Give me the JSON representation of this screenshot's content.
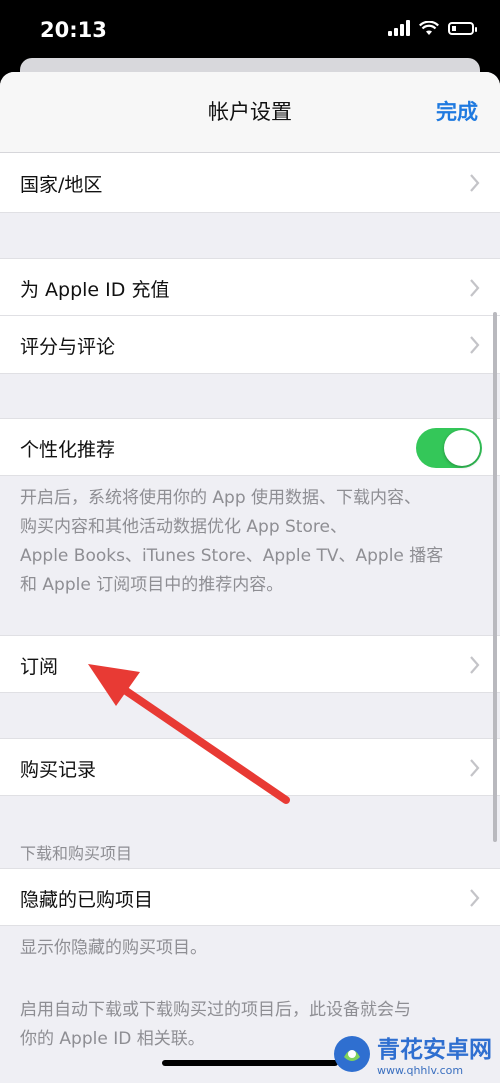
{
  "status_bar": {
    "time": "20:13"
  },
  "nav": {
    "title": "帐户设置",
    "done": "完成"
  },
  "rows": {
    "country_region": "国家/地区",
    "apple_id_topup": "为 Apple ID 充值",
    "ratings_reviews": "评分与评论",
    "personalized": "个性化推荐",
    "subscriptions": "订阅",
    "purchase_history": "购买记录",
    "hidden_purchases": "隐藏的已购项目"
  },
  "personalized_toggle": {
    "on": true,
    "color": "#34c759"
  },
  "personalized_footnote": [
    "开启后，系统将使用你的 App 使用数据、下载内容、",
    "购买内容和其他活动数据优化 App Store、",
    "Apple Books、iTunes Store、Apple TV、Apple 播客",
    "和 Apple 订阅项目中的推荐内容。"
  ],
  "section_downloads_header": "下载和购买项目",
  "hidden_footnote": "显示你隐藏的购买项目。",
  "auto_download_footnote": [
    "启用自动下载或下载购买过的项目后，此设备就会与",
    "你的 Apple ID 相关联。"
  ],
  "watermark": {
    "title": "青花安卓网",
    "url": "www.qhhlv.com"
  },
  "colors": {
    "accent": "#1f7ae0",
    "arrow": "#e83a34",
    "background": "#efeff4"
  }
}
